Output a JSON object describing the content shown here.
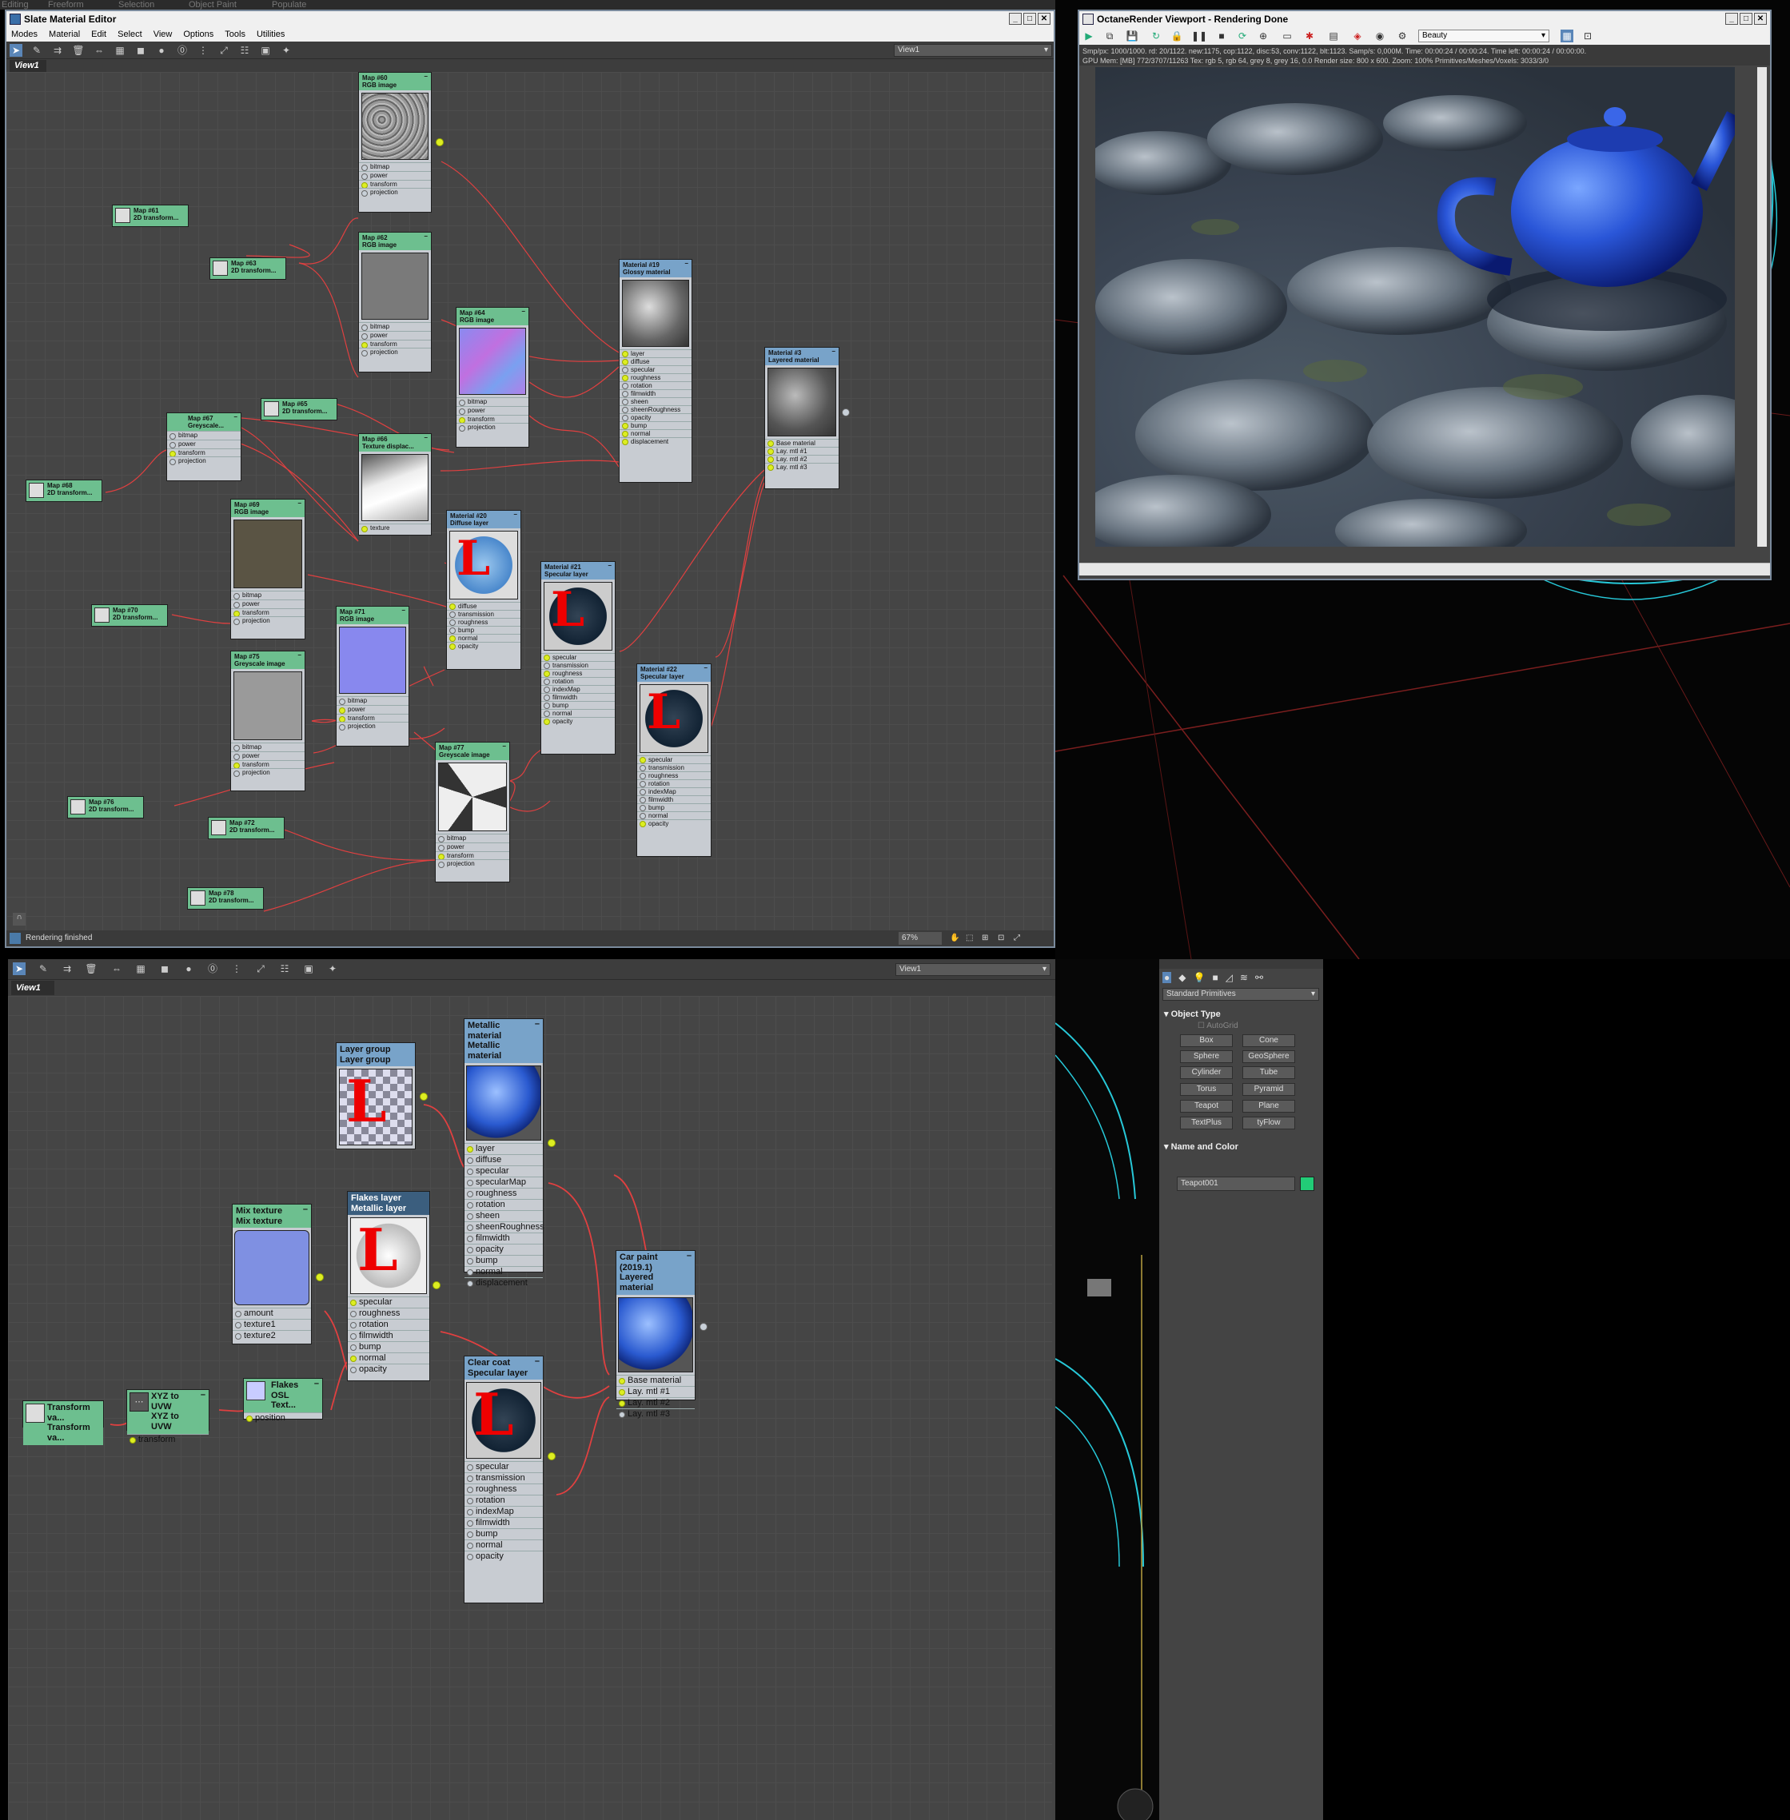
{
  "top_strip": [
    "Editing",
    "Freeform",
    "Selection",
    "Object Paint",
    "Populate"
  ],
  "slate1": {
    "title": "Slate Material Editor",
    "menu": [
      "Modes",
      "Material",
      "Edit",
      "Select",
      "View",
      "Options",
      "Tools",
      "Utilities"
    ],
    "view_select": "View1",
    "tab": "View1",
    "status": "Rendering finished",
    "zoom": "67%",
    "nodes": [
      {
        "id": "m60",
        "title": "Map #60",
        "subtitle": "RGB image",
        "slots": [
          "bitmap",
          "power",
          "transform",
          "projection"
        ]
      },
      {
        "id": "m62",
        "title": "Map #62",
        "subtitle": "RGB image",
        "slots": [
          "bitmap",
          "power",
          "transform",
          "projection"
        ]
      },
      {
        "id": "m64",
        "title": "Map #64",
        "subtitle": "RGB image",
        "slots": [
          "bitmap",
          "power",
          "transform",
          "projection"
        ]
      },
      {
        "id": "m66",
        "title": "Map #66",
        "subtitle": "Texture displac...",
        "slots": [
          "texture"
        ]
      },
      {
        "id": "m67",
        "title": "Map #67",
        "subtitle": "Greyscale...",
        "slots": [
          "bitmap",
          "power",
          "transform",
          "projection"
        ]
      },
      {
        "id": "m69",
        "title": "Map #69",
        "subtitle": "RGB image",
        "slots": [
          "bitmap",
          "power",
          "transform",
          "projection"
        ]
      },
      {
        "id": "m71",
        "title": "Map #71",
        "subtitle": "RGB image",
        "slots": [
          "bitmap",
          "power",
          "transform",
          "projection"
        ]
      },
      {
        "id": "m75",
        "title": "Map #75",
        "subtitle": "Greyscale image",
        "slots": [
          "bitmap",
          "power",
          "transform",
          "projection"
        ]
      },
      {
        "id": "m77",
        "title": "Map #77",
        "subtitle": "Greyscale image",
        "slots": [
          "bitmap",
          "power",
          "transform",
          "projection"
        ]
      },
      {
        "id": "mat19",
        "title": "Material #19",
        "subtitle": "Glossy material",
        "slots": [
          "layer",
          "diffuse",
          "specular",
          "roughness",
          "rotation",
          "filmwidth",
          "sheen",
          "sheenRoughness",
          "opacity",
          "bump",
          "normal",
          "displacement"
        ]
      },
      {
        "id": "mat20",
        "title": "Material #20",
        "subtitle": "Diffuse layer",
        "slots": [
          "diffuse",
          "transmission",
          "roughness",
          "bump",
          "normal",
          "opacity"
        ]
      },
      {
        "id": "mat21",
        "title": "Material #21",
        "subtitle": "Specular layer",
        "slots": [
          "specular",
          "transmission",
          "roughness",
          "rotation",
          "indexMap",
          "filmwidth",
          "bump",
          "normal",
          "opacity"
        ]
      },
      {
        "id": "mat22",
        "title": "Material #22",
        "subtitle": "Specular layer",
        "slots": [
          "specular",
          "transmission",
          "roughness",
          "rotation",
          "indexMap",
          "filmwidth",
          "bump",
          "normal",
          "opacity"
        ]
      },
      {
        "id": "mat3",
        "title": "Material #3",
        "subtitle": "Layered material",
        "slots": [
          "Base material",
          "Lay. mtl #1",
          "Lay. mtl #2",
          "Lay. mtl #3"
        ]
      }
    ],
    "small_maps": [
      {
        "title": "Map #61",
        "subtitle": "2D transform..."
      },
      {
        "title": "Map #63",
        "subtitle": "2D transform..."
      },
      {
        "title": "Map #65",
        "subtitle": "2D transform..."
      },
      {
        "title": "Map #68",
        "subtitle": "2D transform..."
      },
      {
        "title": "Map #70",
        "subtitle": "2D transform..."
      },
      {
        "title": "Map #76",
        "subtitle": "2D transform..."
      },
      {
        "title": "Map #72",
        "subtitle": "2D transform..."
      },
      {
        "title": "Map #78",
        "subtitle": "2D transform..."
      }
    ]
  },
  "octane": {
    "title": "OctaneRender Viewport - Rendering Done",
    "pass_select": "Beauty",
    "stats_line1": "Smp/px: 1000/1000.   rd: 20/1122.   new:1175, cop:1122, disc:53, conv:1122, blt:1123.   Samp/s: 0,000M.   Time: 00:00:24 / 00:00:24.   Time left: 00:00:24 / 00:00:00.",
    "stats_line2": "GPU Mem: [MB] 772/3707/11263   Tex: rgb 5, rgb 64, grey 8, grey 16, 0.0   Render size: 800 x 600.   Zoom: 100%   Primitives/Meshes/Voxels: 3033/3/0"
  },
  "slate2": {
    "view_select": "View1",
    "tab": "View1",
    "nodes": [
      {
        "id": "layergroup",
        "title": "Layer group",
        "subtitle": "Layer group",
        "slots": []
      },
      {
        "id": "metallic",
        "title": "Metallic material",
        "subtitle": "Metallic material",
        "slots": [
          "layer",
          "diffuse",
          "specular",
          "specularMap",
          "roughness",
          "rotation",
          "sheen",
          "sheenRoughness",
          "filmwidth",
          "opacity",
          "bump",
          "normal",
          "displacement"
        ]
      },
      {
        "id": "mix",
        "title": "Mix texture",
        "subtitle": "Mix texture",
        "slots": [
          "amount",
          "texture1",
          "texture2"
        ]
      },
      {
        "id": "flakes",
        "title": "Flakes layer",
        "subtitle": "Metallic layer",
        "slots": [
          "specular",
          "roughness",
          "rotation",
          "filmwidth",
          "bump",
          "normal",
          "opacity"
        ]
      },
      {
        "id": "carpaint",
        "title": "Car paint (2019.1)",
        "subtitle": "Layered material",
        "slots": [
          "Base material",
          "Lay. mtl #1",
          "Lay. mtl #2",
          "Lay. mtl #3"
        ]
      },
      {
        "id": "clearcoat",
        "title": "Clear coat",
        "subtitle": "Specular layer",
        "slots": [
          "specular",
          "transmission",
          "roughness",
          "rotation",
          "indexMap",
          "filmwidth",
          "bump",
          "normal",
          "opacity"
        ]
      },
      {
        "id": "flakesosl",
        "title": "Flakes",
        "subtitle": "OSL Text...",
        "slots": [
          "position"
        ]
      },
      {
        "id": "xyz",
        "title": "XYZ to UVW",
        "subtitle": "XYZ to UVW",
        "slots": [
          "transform"
        ]
      },
      {
        "id": "transformva",
        "title": "Transform va...",
        "subtitle": "Transform va...",
        "slots": []
      }
    ]
  },
  "create_panel": {
    "dropdown": "Standard Primitives",
    "object_type_header": "Object Type",
    "autogrid": "AutoGrid",
    "buttons": [
      "Box",
      "Cone",
      "Sphere",
      "GeoSphere",
      "Cylinder",
      "Tube",
      "Torus",
      "Pyramid",
      "Teapot",
      "Plane",
      "TextPlus",
      "tyFlow"
    ],
    "name_color_header": "Name and Color",
    "object_name": "Teapot001",
    "object_color": "#22cc77"
  },
  "colors": {
    "map_header": "#6dbf8f",
    "material_header": "#78a3c9",
    "wire": "#e04040",
    "port": "#ddee22"
  }
}
